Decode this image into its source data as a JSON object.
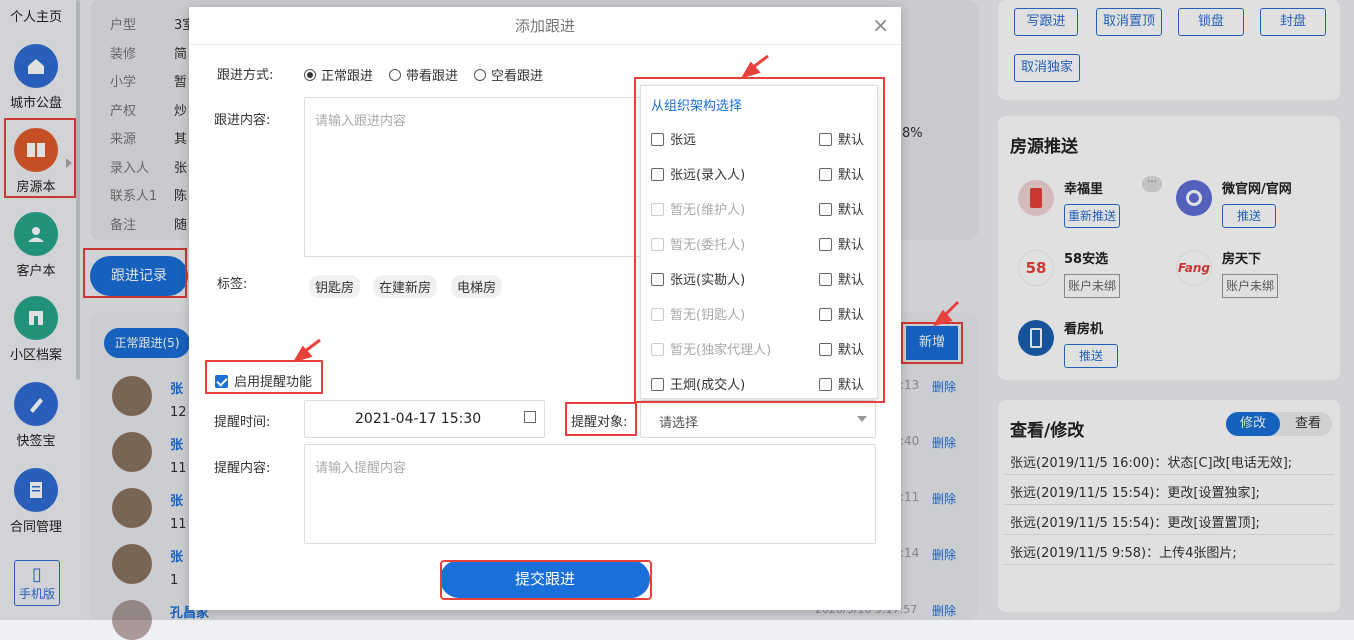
{
  "sidebar": {
    "items": [
      {
        "label": "个人主页",
        "color": "#2f6dd4",
        "icon": "user-icon"
      },
      {
        "label": "城市公盘",
        "color": "#2f6dd4",
        "icon": "home-icon"
      },
      {
        "label": "房源本",
        "color": "#e05a2b",
        "icon": "book-icon"
      },
      {
        "label": "客户本",
        "color": "#27a58b",
        "icon": "customer-icon"
      },
      {
        "label": "小区档案",
        "color": "#27a58b",
        "icon": "building-icon"
      },
      {
        "label": "快签宝",
        "color": "#2f6dd4",
        "icon": "sign-icon"
      },
      {
        "label": "合同管理",
        "color": "#2f6dd4",
        "icon": "contract-icon"
      }
    ],
    "mobile": "手机版"
  },
  "info": {
    "rows": [
      {
        "k": "户型",
        "v": "3室"
      },
      {
        "k": "装修",
        "v": "简"
      },
      {
        "k": "小学",
        "v": "暂"
      },
      {
        "k": "产权",
        "v": "炒"
      },
      {
        "k": "来源",
        "v": "其"
      },
      {
        "k": "录入人",
        "v": "张"
      },
      {
        "k": "联系人1",
        "v": "陈"
      },
      {
        "k": "备注",
        "v": "随"
      }
    ],
    "percent": "8%"
  },
  "tabs": {
    "follow_record": "跟进记录",
    "normal_follow": "正常跟进(5)",
    "add": "新增"
  },
  "records": [
    {
      "name": "张",
      "sub": "12",
      "time": ":13",
      "del": "删除"
    },
    {
      "name": "张",
      "sub": "11",
      "time": ":40",
      "del": "删除"
    },
    {
      "name": "张",
      "sub": "11",
      "time": ":11",
      "del": "删除"
    },
    {
      "name": "张",
      "sub": "1",
      "time": ":14",
      "del": "删除"
    },
    {
      "name": "孔昌家",
      "sub": "",
      "time": "2020/3/10 9:17:57",
      "del": "删除"
    }
  ],
  "dialog": {
    "title": "添加跟进",
    "method_label": "跟进方式:",
    "methods": [
      "正常跟进",
      "带看跟进",
      "空看跟进"
    ],
    "content_label": "跟进内容:",
    "content_placeholder": "请输入跟进内容",
    "tags_label": "标签:",
    "tags": [
      "钥匙房",
      "在建新房",
      "电梯房"
    ],
    "reminder_enable": "启用提醒功能",
    "remind_time_label": "提醒时间:",
    "remind_time": "2021-04-17 15:30",
    "remind_target_label": "提醒对象:",
    "remind_target_placeholder": "请选择",
    "remind_content_label": "提醒内容:",
    "remind_content_placeholder": "请输入提醒内容",
    "submit": "提交跟进"
  },
  "dropdown": {
    "org_link": "从组织架构选择",
    "default_label": "默认",
    "items": [
      {
        "name": "张远",
        "disabled": false
      },
      {
        "name": "张远(录入人)",
        "disabled": false
      },
      {
        "name": "暂无(维护人)",
        "disabled": true
      },
      {
        "name": "暂无(委托人)",
        "disabled": true
      },
      {
        "name": "张远(实勘人)",
        "disabled": false
      },
      {
        "name": "暂无(钥匙人)",
        "disabled": true
      },
      {
        "name": "暂无(独家代理人)",
        "disabled": true
      },
      {
        "name": "王炯(成交人)",
        "disabled": false
      }
    ]
  },
  "actions": {
    "write_follow": "写跟进",
    "cancel_top": "取消置顶",
    "lock": "锁盘",
    "seal": "封盘",
    "cancel_exclusive": "取消独家"
  },
  "push": {
    "title": "房源推送",
    "more": "···",
    "items": [
      {
        "name": "幸福里",
        "btn": "重新推送",
        "btn_type": "blue"
      },
      {
        "name": "微官网/官网",
        "btn": "推送",
        "btn_type": "blue"
      },
      {
        "name": "58安选",
        "btn": "账户未绑",
        "btn_type": "gray"
      },
      {
        "name": "房天下",
        "btn": "账户未绑",
        "btn_type": "gray"
      },
      {
        "name": "看房机",
        "btn": "推送",
        "btn_type": "blue"
      }
    ]
  },
  "view_edit": {
    "title": "查看/修改",
    "tab_edit": "修改",
    "tab_view": "查看",
    "logs": [
      "张远(2019/11/5 16:00)：状态[C]改[电话无效];",
      "张远(2019/11/5 15:54)：更改[设置独家];",
      "张远(2019/11/5 15:54)：更改[设置置顶];",
      "张远(2019/11/5 9:58)：上传4张图片;"
    ]
  }
}
